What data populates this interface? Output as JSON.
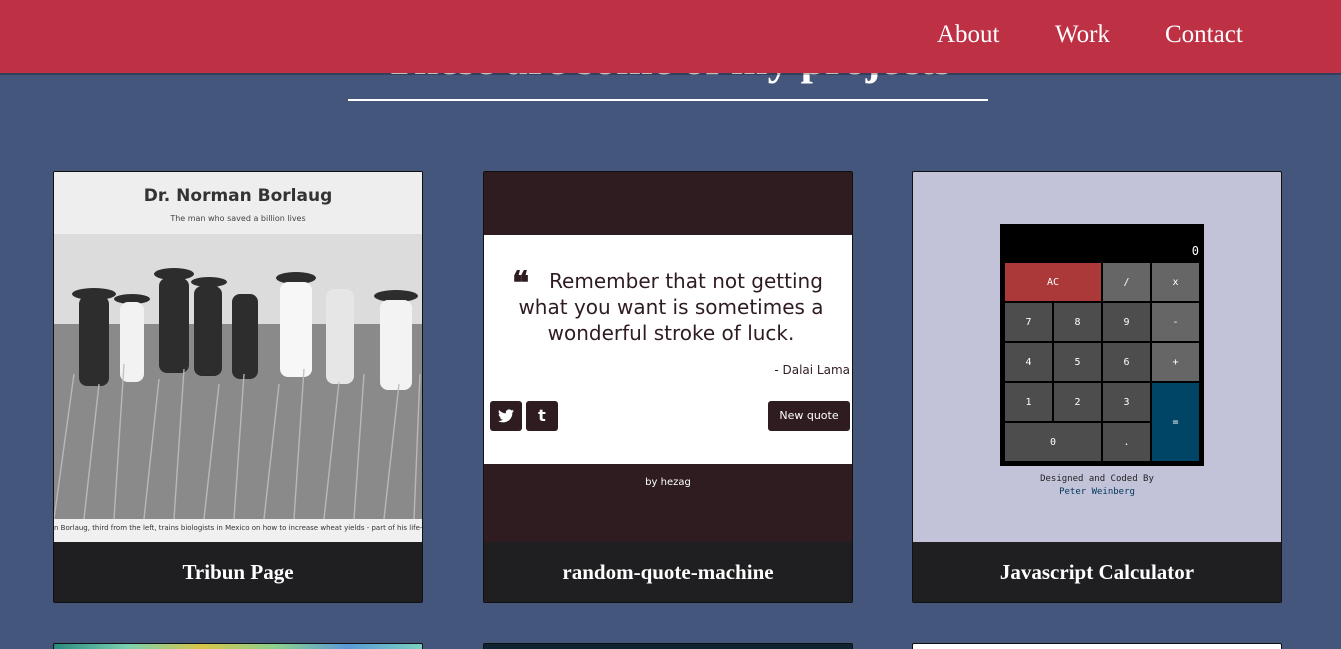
{
  "nav": {
    "about": "About",
    "work": "Work",
    "contact": "Contact"
  },
  "colors": {
    "nav_bg": "#be3144",
    "page_bg": "#45567d",
    "tile_title_bg": "#1f1f22"
  },
  "heading": "These are some of my projects",
  "projects": [
    {
      "title": "Tribun Page",
      "thumb": {
        "title": "Dr. Norman Borlaug",
        "subtitle": "The man who saved a billion lives",
        "caption": "n Borlaug, third from the left, trains biologists in Mexico on how to increase wheat yields - part of his life-long war o"
      }
    },
    {
      "title": "random-quote-machine",
      "thumb": {
        "quote": "Remember that not getting what you want is sometimes a wonderful stroke of luck.",
        "author": "- Dalai Lama",
        "twitter_icon": "twitter-icon",
        "tumblr_icon": "tumblr-icon",
        "new_quote": "New quote",
        "byline": "by hezag"
      }
    },
    {
      "title": "Javascript Calculator",
      "thumb": {
        "display": "0",
        "keys": [
          "AC",
          "/",
          "x",
          "7",
          "8",
          "9",
          "-",
          "4",
          "5",
          "6",
          "+",
          "1",
          "2",
          "3",
          "=",
          "0",
          "."
        ],
        "credit_line": "Designed and Coded By",
        "credit_name": "Peter Weinberg"
      }
    }
  ]
}
